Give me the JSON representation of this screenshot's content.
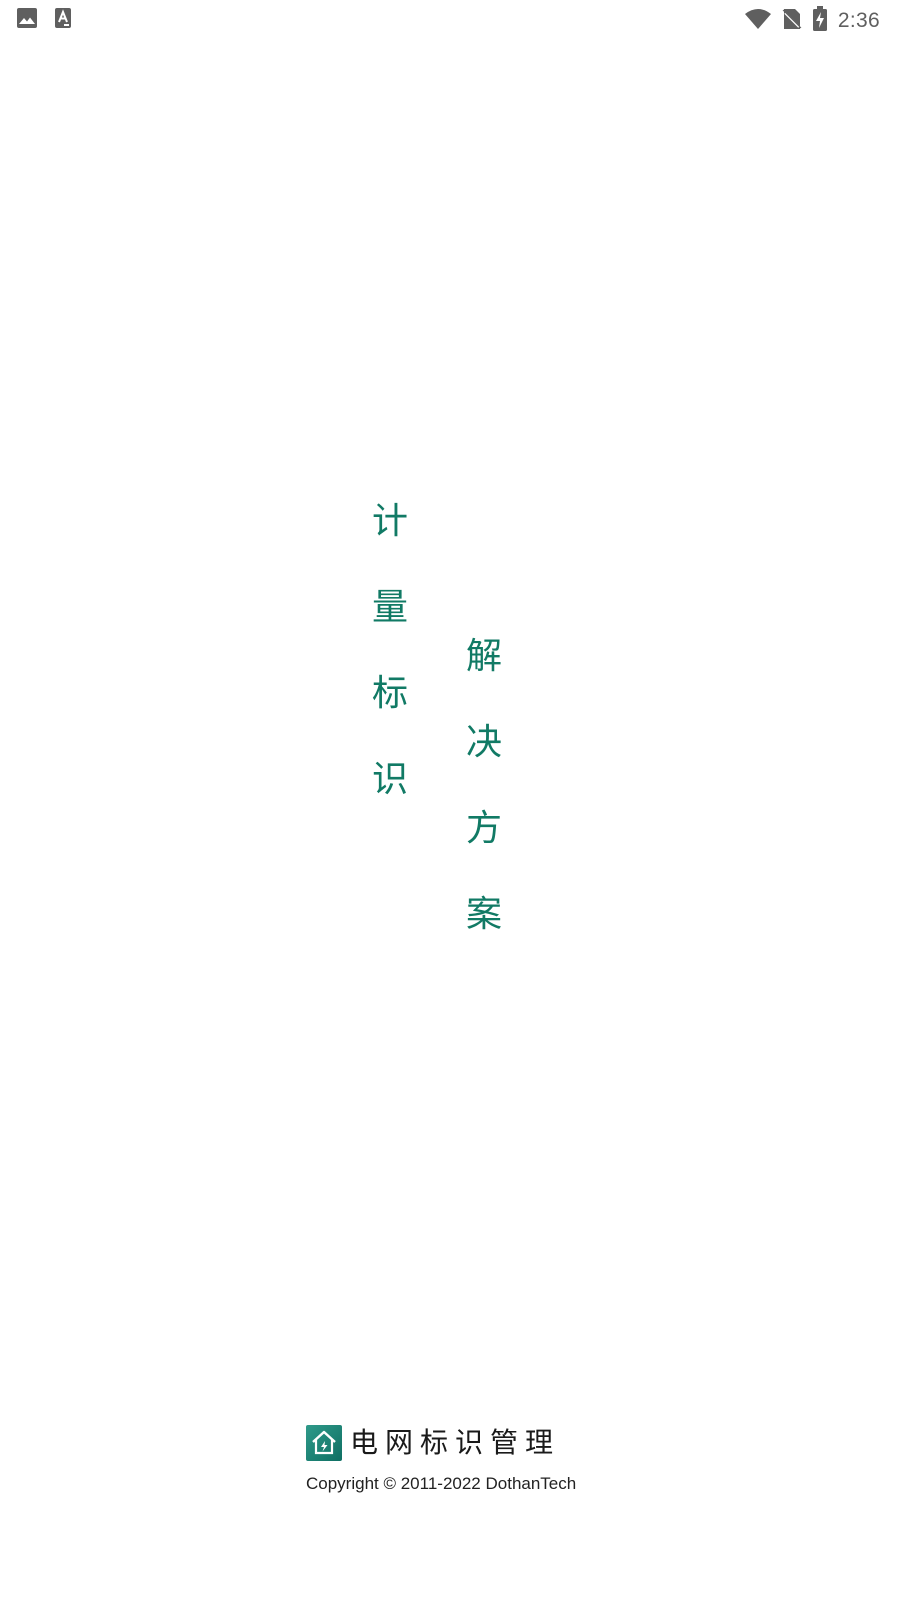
{
  "status_bar": {
    "time": "2:36",
    "left_icons": [
      "image-icon",
      "text-a-icon"
    ],
    "right_icons": [
      "wifi-icon",
      "no-sim-icon",
      "battery-charging-icon"
    ]
  },
  "slogan": {
    "column_left": [
      "计",
      "量",
      "标",
      "识"
    ],
    "column_right": [
      "解",
      "决",
      "方",
      "案"
    ],
    "color": "#117a65"
  },
  "footer": {
    "logo_icon": "house-logo-icon",
    "brand_name": "电网标识管理",
    "copyright": "Copyright © 2011-2022 DothanTech"
  }
}
